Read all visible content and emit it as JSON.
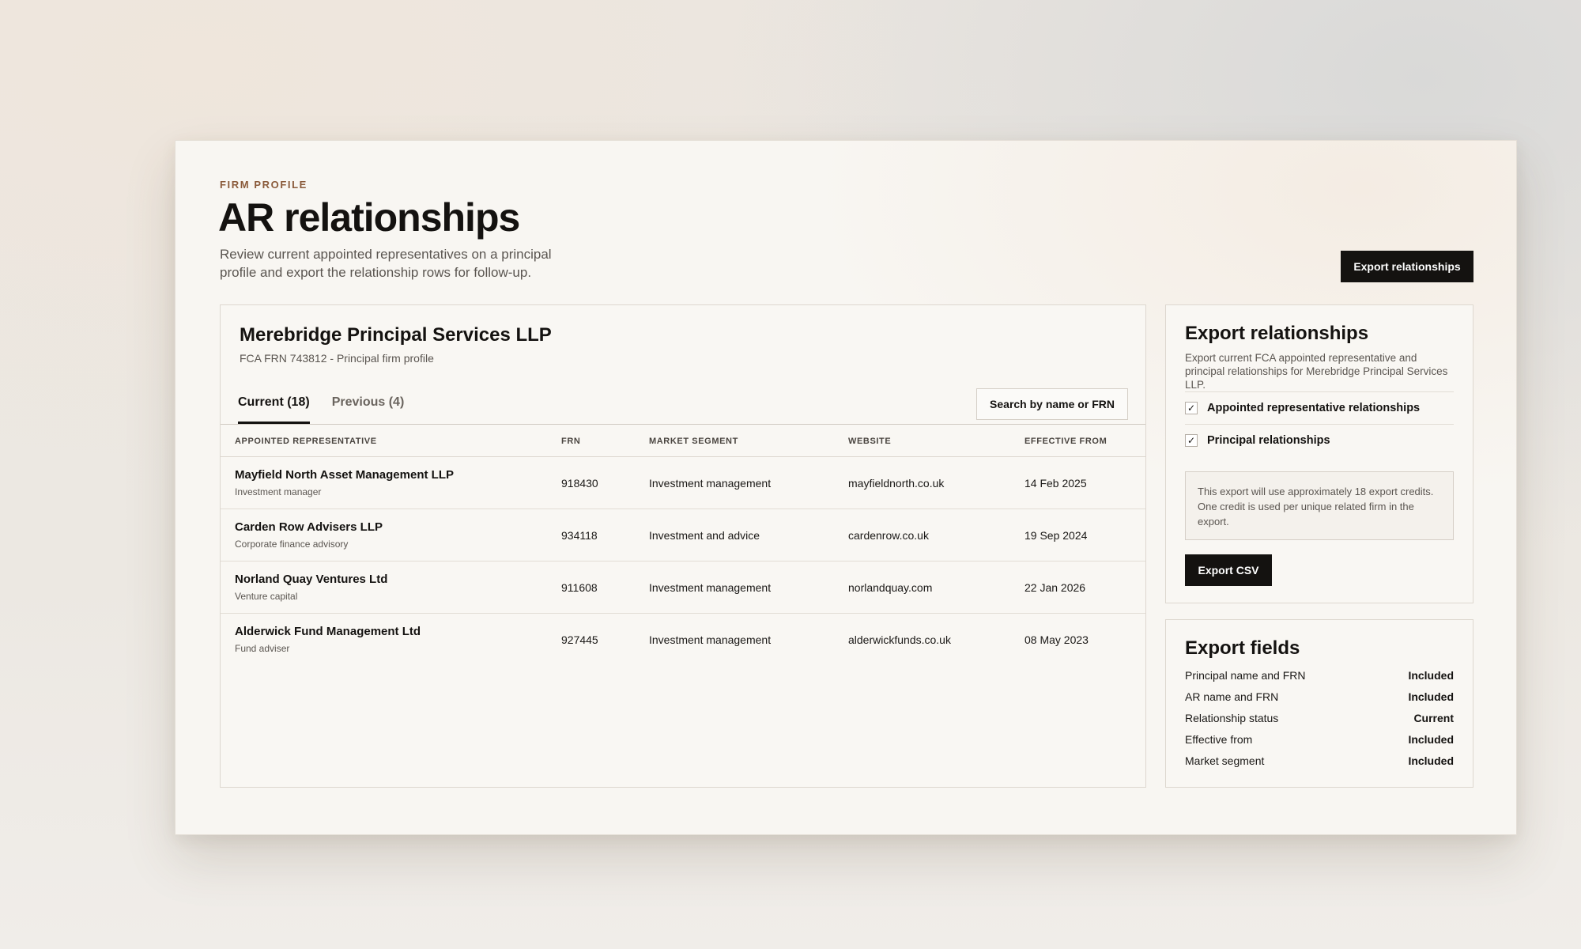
{
  "header": {
    "eyebrow": "FIRM PROFILE",
    "title": "AR relationships",
    "description": "Review current appointed representatives on a principal profile and export the relationship rows for follow-up.",
    "export_button": "Export relationships"
  },
  "firm": {
    "name": "Merebridge Principal Services LLP",
    "meta": "FCA FRN 743812 - Principal firm profile"
  },
  "tabs": [
    {
      "label": "Current (18)",
      "active": true
    },
    {
      "label": "Previous (4)",
      "active": false
    }
  ],
  "search": {
    "label": "Search by name or FRN"
  },
  "table": {
    "columns": [
      "APPOINTED REPRESENTATIVE",
      "FRN",
      "MARKET SEGMENT",
      "WEBSITE",
      "EFFECTIVE FROM"
    ],
    "rows": [
      {
        "name": "Mayfield North Asset Management LLP",
        "sub": "Investment manager",
        "frn": "918430",
        "segment": "Investment management",
        "website": "mayfieldnorth.co.uk",
        "effective": "14 Feb 2025"
      },
      {
        "name": "Carden Row Advisers LLP",
        "sub": "Corporate finance advisory",
        "frn": "934118",
        "segment": "Investment and advice",
        "website": "cardenrow.co.uk",
        "effective": "19 Sep 2024"
      },
      {
        "name": "Norland Quay Ventures Ltd",
        "sub": "Venture capital",
        "frn": "911608",
        "segment": "Investment management",
        "website": "norlandquay.com",
        "effective": "22 Jan 2026"
      },
      {
        "name": "Alderwick Fund Management Ltd",
        "sub": "Fund adviser",
        "frn": "927445",
        "segment": "Investment management",
        "website": "alderwickfunds.co.uk",
        "effective": "08 May 2023"
      }
    ]
  },
  "export_panel": {
    "title": "Export relationships",
    "description": "Export current FCA appointed representative and principal relationships for Merebridge Principal Services LLP.",
    "options": [
      {
        "label": "Appointed representative relationships",
        "checked": true
      },
      {
        "label": "Principal relationships",
        "checked": true
      }
    ],
    "check_glyph": "✓",
    "note": "This export will use approximately 18 export credits. One credit is used per unique related firm in the export.",
    "button": "Export CSV"
  },
  "fields_panel": {
    "title": "Export fields",
    "fields": [
      {
        "name": "Principal name and FRN",
        "value": "Included"
      },
      {
        "name": "AR name and FRN",
        "value": "Included"
      },
      {
        "name": "Relationship status",
        "value": "Current"
      },
      {
        "name": "Effective from",
        "value": "Included"
      },
      {
        "name": "Market segment",
        "value": "Included"
      }
    ]
  }
}
